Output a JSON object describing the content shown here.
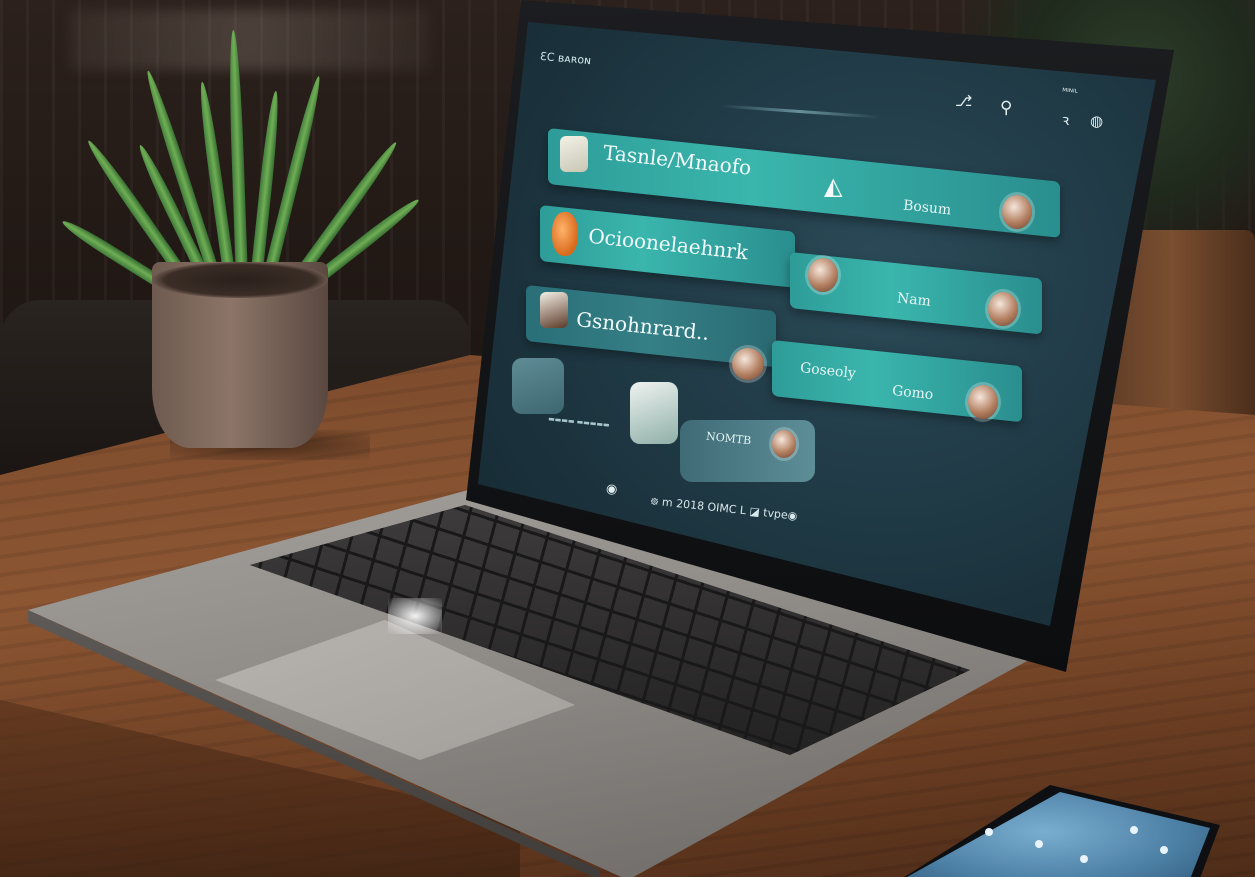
{
  "screen": {
    "brand_label": "ƐC ʙᴀʀᴏɴ",
    "top_right_text": "ᴹᴵᴺᴵᴸ",
    "top_icons": [
      "settings-icon",
      "user-icon",
      "search-icon",
      "globe-icon"
    ],
    "cards": [
      {
        "label": "Tasnle/Mnaofo",
        "sub": "Bosum"
      },
      {
        "label": "Ocioonelaehnrk",
        "sub": "Nam"
      },
      {
        "label": "Gsnohnrard..",
        "sub": "Goseoly"
      },
      {
        "label": "",
        "sub": "Gomo"
      }
    ],
    "small_tile_label": "NOMTB",
    "bottom_bar": "᪥ m 2018 OIMC  L  ◪ tvpe◉"
  },
  "colors": {
    "card_teal": "#3ab6ad",
    "screen_bg": "#1d3641",
    "table_wood": "#8c5633"
  }
}
